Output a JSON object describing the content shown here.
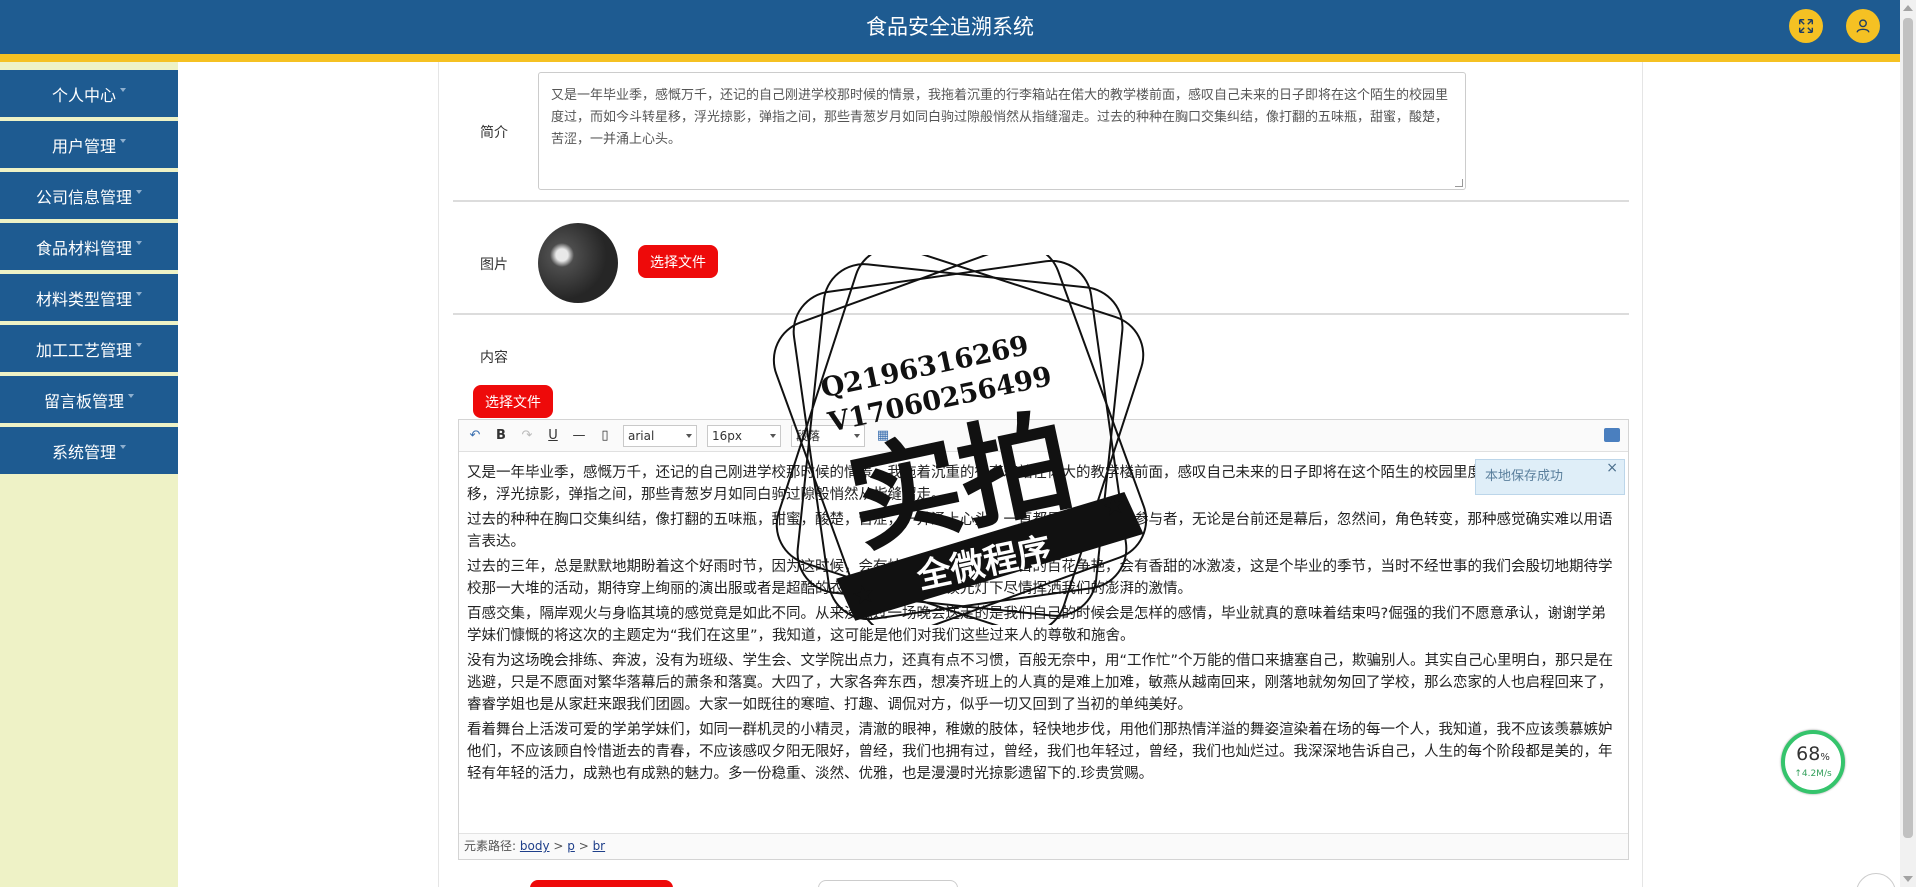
{
  "header": {
    "title": "食品安全追溯系统",
    "brand_color": "#1e5b91",
    "accent_color": "#f5c123",
    "fullscreen_icon": "expand-icon",
    "user_icon": "user-icon"
  },
  "sidebar": {
    "items": [
      {
        "label": "个人中心"
      },
      {
        "label": "用户管理"
      },
      {
        "label": "公司信息管理"
      },
      {
        "label": "食品材料管理"
      },
      {
        "label": "材料类型管理"
      },
      {
        "label": "加工工艺管理"
      },
      {
        "label": "留言板管理"
      },
      {
        "label": "系统管理"
      }
    ]
  },
  "form": {
    "intro_label": "简介",
    "intro_text": "又是一年毕业季，感慨万千，还记的自己刚进学校那时候的情景，我拖着沉重的行李箱站在偌大的教学楼前面，感叹自己未来的日子即将在这个陌生的校园里度过，而如今斗转星移，浮光掠影，弹指之间，那些青葱岁月如同白驹过隙般悄然从指缝溜走。过去的种种在胸口交集纠结，像打翻的五味瓶，甜蜜，酸楚，苦涩，一并涌上心头。",
    "image_label": "图片",
    "image_button": "选择文件",
    "content_label": "内容",
    "content_button": "选择文件"
  },
  "editor": {
    "font_family": "arial",
    "font_size": "16px",
    "style_select": "段落",
    "toast": "本地保存成功",
    "toast_close": "×",
    "paragraphs": [
      "又是一年毕业季，感慨万千，还记的自己刚进学校那时候的情景，我拖着沉重的行李箱站在偌大的教学楼前面，感叹自己未来的日子即将在这个陌生的校园里度过，而如今斗转星移，浮光掠影，弹指之间，那些青葱岁月如同白驹过隙般悄然从指缝溜走。",
      "过去的种种在胸口交集纠结，像打翻的五味瓶，甜蜜，酸楚，苦涩，一并涌上心头。一直都是晚会的忠实参与者，无论是台前还是幕后，忽然间，角色转变，那种感觉确实难以用语言表达。",
      "过去的三年，总是默默地期盼着这个好雨时节，因为这时候，会有灿烂的阳光，会有满目的百花争艳，会有香甜的冰激凌，这是个毕业的季节，当时不经世事的我们会殷切地期待学校那一大堆的活动，期待穿上绚丽的演出服或者是超酷的衣服，站在大礼堂镁光灯下尽情挥洒我们的澎湃的激情。",
      "百感交集，隔岸观火与身临其境的感觉竟是如此不同。从来没想过一场晚会送走的是我们自己的时候会是怎样的感情，毕业就真的意味着结束吗?倔强的我们不愿意承认，谢谢学弟学妹们慷慨的将这次的主题定为“我们在这里”，我知道，这可能是他们对我们这些过来人的尊敬和施舍。",
      "没有为这场晚会排练、奔波，没有为班级、学生会、文学院出点力，还真有点不习惯，百般无奈中，用“工作忙”个万能的借口来搪塞自己，欺骗别人。其实自己心里明白，那只是在逃避，只是不愿面对繁华落幕后的萧条和落寞。大四了，大家各奔东西，想凑齐班上的人真的是难上加难，敏燕从越南回来，刚落地就匆匆回了学校，那么恋家的人也启程回来了，睿睿学姐也是从家赶来跟我们团圆。大家一如既往的寒暄、打趣、调侃对方，似乎一切又回到了当初的单纯美好。",
      "看着舞台上活泼可爱的学弟学妹们，如同一群机灵的小精灵，清澈的眼神，稚嫩的肢体，轻快地步伐，用他们那热情洋溢的舞姿渲染着在场的每一个人，我知道，我不应该羡慕嫉妒他们，不应该顾自怜惜逝去的青春，不应该感叹夕阳无限好，曾经，我们也拥有过，曾经，我们也年轻过，曾经，我们也灿烂过。我深深地告诉自己，人生的每个阶段都是美的，年轻有年轻的活力，成熟也有成熟的魅力。多一份稳重、淡然、优雅，也是漫漫时光掠影遗留下的.珍贵赏赐。"
    ],
    "path_label": "元素路径:",
    "path_body": "body",
    "path_sep1": " > ",
    "path_p": "p",
    "path_sep2": " > ",
    "path_br": "br"
  },
  "speed_widget": {
    "percent": "68",
    "percent_unit": "%",
    "rate": "↑4.2M/s"
  },
  "stamp": {
    "line1": "Q2196316269",
    "line2": "V17060256499",
    "big": "实拍",
    "banner": "全微程序"
  }
}
